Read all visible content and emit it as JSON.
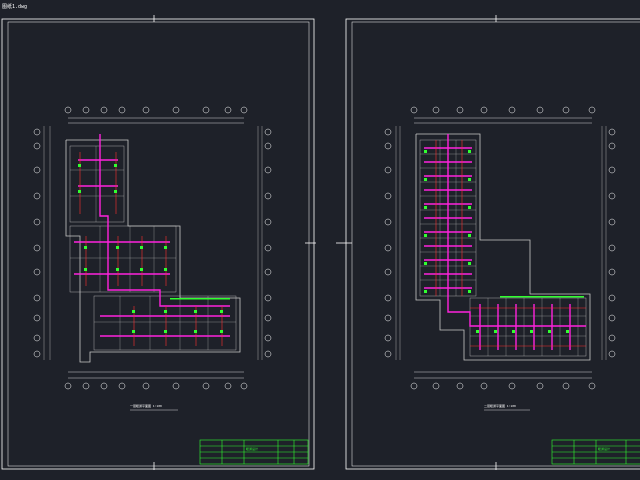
{
  "viewport": {
    "background": "#1e2129",
    "top_label": "图纸1.dwg"
  },
  "colors": {
    "sheet_frame": "#ffffff",
    "axis_lines": "#ffffff",
    "walls": "#c8c8c8",
    "duct_magenta": "#ff22dd",
    "pipe_red": "#ff3030",
    "fixtures_green": "#30ff30",
    "title_block": "#30ff30",
    "grid_bubbles": "#ffffff"
  },
  "sheets": [
    {
      "id": "sheet-left",
      "caption": "一层暖通平面图 1:100",
      "title_block_text": "暖通设计"
    },
    {
      "id": "sheet-right",
      "caption": "二层暖通平面图 1:100",
      "title_block_text": "暖通设计"
    }
  ]
}
